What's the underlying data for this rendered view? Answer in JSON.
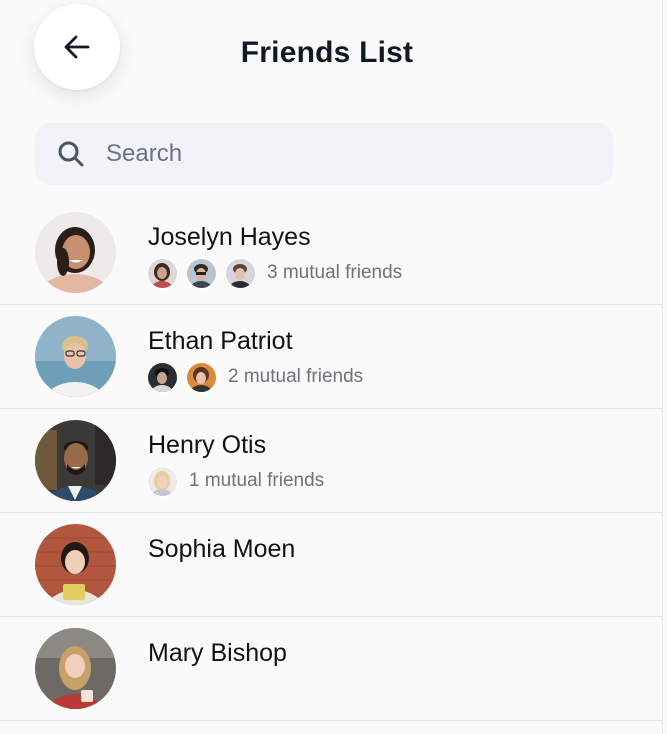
{
  "header": {
    "title": "Friends List",
    "back_icon": "arrow-left-icon"
  },
  "search": {
    "placeholder": "Search",
    "value": "",
    "icon": "search-icon"
  },
  "friends": [
    {
      "name": "Joselyn Hayes",
      "mutual_text": "3 mutual friends",
      "mutual_count": 3
    },
    {
      "name": "Ethan Patriot",
      "mutual_text": "2 mutual friends",
      "mutual_count": 2
    },
    {
      "name": "Henry Otis",
      "mutual_text": "1 mutual friends",
      "mutual_count": 1
    },
    {
      "name": "Sophia Moen",
      "mutual_text": "",
      "mutual_count": 0
    },
    {
      "name": "Mary Bishop",
      "mutual_text": "",
      "mutual_count": 0
    }
  ],
  "colors": {
    "background": "#fafafa",
    "search_bg": "#f1f3f8",
    "title": "#111827",
    "muted_text": "#6b7280",
    "divider": "#e6e6ea"
  }
}
